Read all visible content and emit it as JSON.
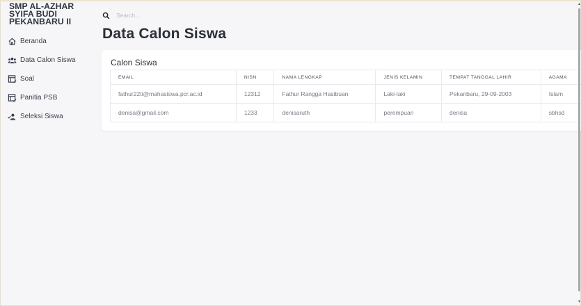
{
  "sidebar": {
    "brand": "SMP AL-AZHAR SYIFA BUDI PEKANBARU II",
    "items": [
      {
        "label": "Beranda",
        "icon": "home-icon"
      },
      {
        "label": "Data Calon Siswa",
        "icon": "users-icon"
      },
      {
        "label": "Soal",
        "icon": "document-edit-icon"
      },
      {
        "label": "Panitia PSB",
        "icon": "document-check-icon"
      },
      {
        "label": "Seleksi Siswa",
        "icon": "user-check-icon"
      }
    ]
  },
  "topbar": {
    "search_placeholder": "Search..."
  },
  "page": {
    "title": "Data Calon Siswa"
  },
  "card": {
    "title": "Calon Siswa",
    "columns": [
      "EMAIL",
      "NISN",
      "NAMA LENGKAP",
      "JENIS KELAMIN",
      "TEMPAT TANGGAL LAHIR",
      "AGAMA"
    ],
    "rows": [
      [
        "fathur22ti@mahasiswa.pcr.ac.id",
        "12312",
        "Fathur Rangga Hasibuan",
        "Laki-laki",
        "Pekanbaru, 29-09-2003",
        "Islam"
      ],
      [
        "denisa@gmail.com",
        "1233",
        "denisaruth",
        "perempuan",
        "denisa",
        "sbhsd"
      ]
    ]
  }
}
